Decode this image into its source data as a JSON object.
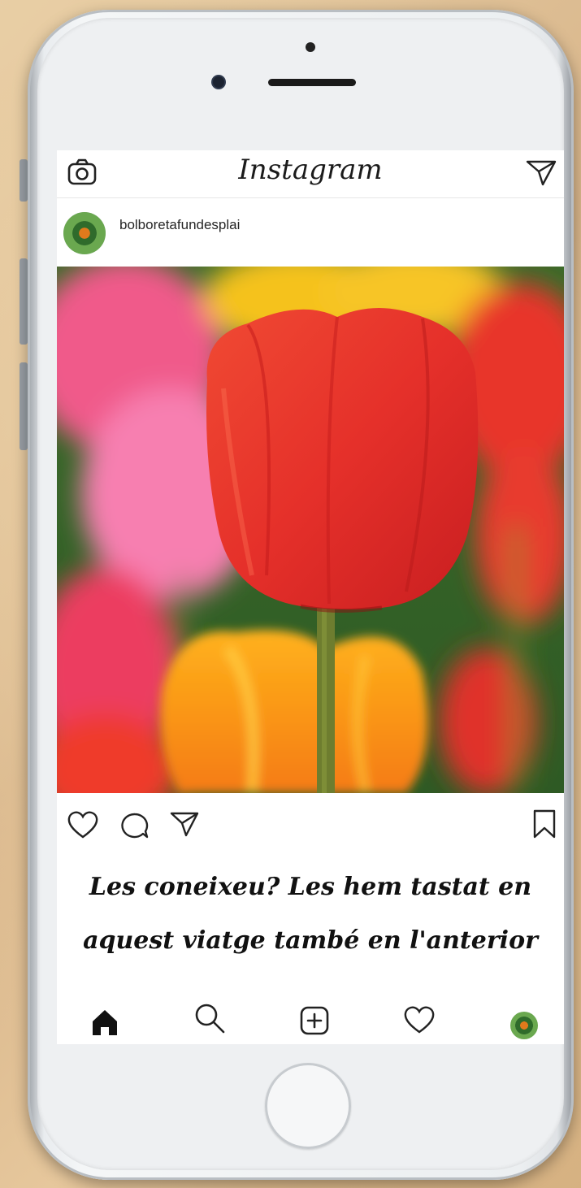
{
  "app": {
    "title": "Instagram"
  },
  "post": {
    "username": "bolboretafundesplai",
    "caption_line1": "Les coneixeu? Les hem tastat en",
    "caption_line2": "aquest viatge també en l'anterior",
    "image_subject": "red tulip close-up with pink, yellow and orange tulips"
  },
  "icons": {
    "top": [
      "camera-icon",
      "send-icon"
    ],
    "actions": [
      "heart-icon",
      "comment-icon",
      "share-icon",
      "bookmark-icon"
    ],
    "nav": [
      "home-icon",
      "search-icon",
      "add-post-icon",
      "activity-heart-icon",
      "profile-avatar"
    ]
  },
  "colors": {
    "tulip_red": "#e8382a",
    "text": "#262626",
    "background_paper": "#e3c59b"
  }
}
